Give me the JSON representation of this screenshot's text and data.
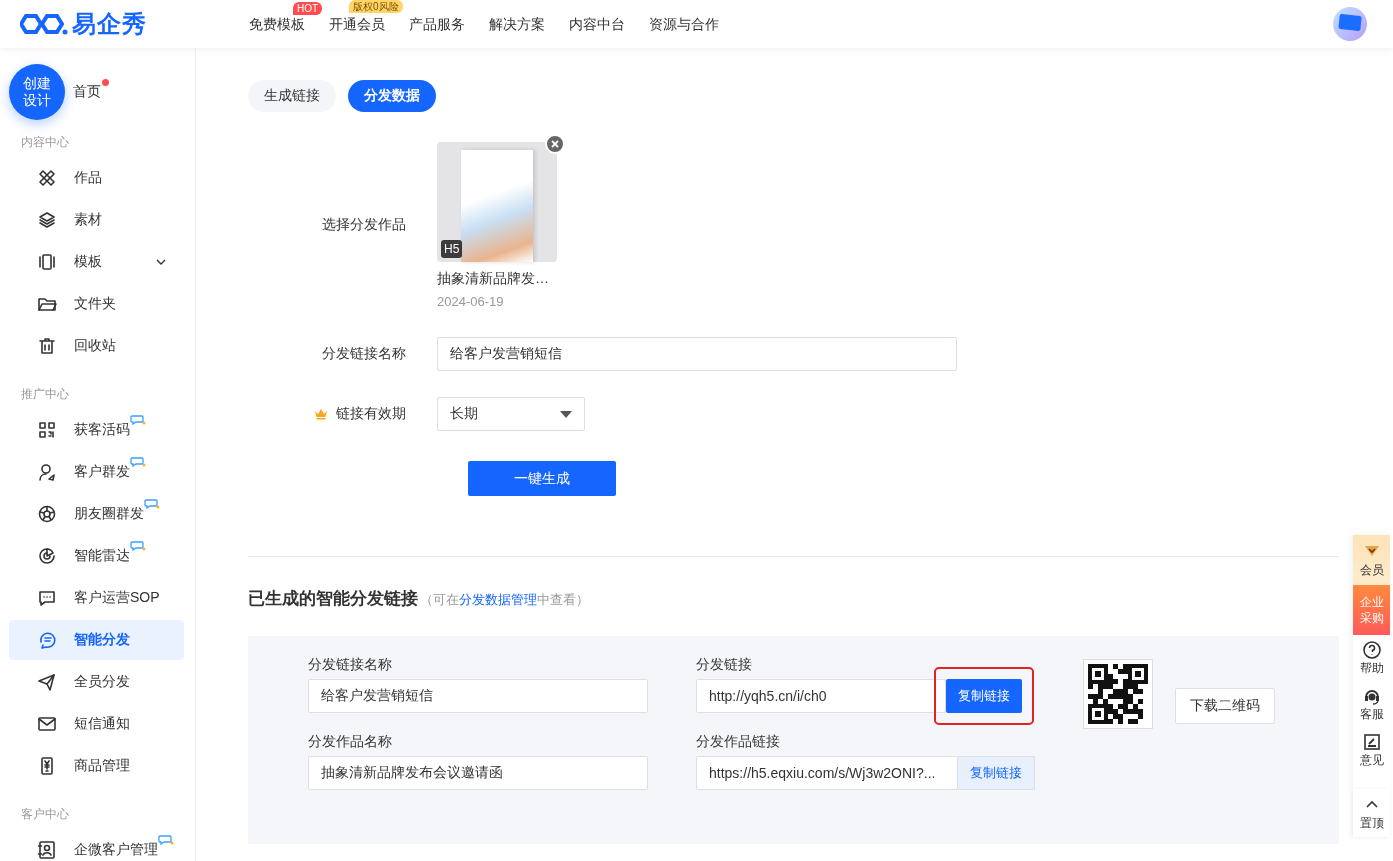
{
  "header": {
    "logo": "易企秀",
    "nav": [
      {
        "label": "免费模板",
        "badge": "HOT",
        "color": "#ff4d4f"
      },
      {
        "label": "开通会员",
        "badge": "版权0风险",
        "color": "#ffd666"
      },
      {
        "label": "产品服务"
      },
      {
        "label": "解决方案"
      },
      {
        "label": "内容中台"
      },
      {
        "label": "资源与合作"
      }
    ]
  },
  "sidebar": {
    "create_button": "创建设计",
    "home": {
      "label": "首页",
      "dot": true
    },
    "sections": [
      {
        "title": "内容中心",
        "items": [
          {
            "label": "作品",
            "kind": "tools",
            "selected": false
          },
          {
            "label": "素材",
            "kind": "layers",
            "selected": false
          },
          {
            "label": "模板",
            "kind": "template",
            "selected": false,
            "expandable": true
          },
          {
            "label": "文件夹",
            "kind": "folder",
            "selected": false
          },
          {
            "label": "回收站",
            "kind": "trash",
            "selected": false
          }
        ]
      },
      {
        "title": "推广中心",
        "items": [
          {
            "label": "获客活码",
            "kind": "qr",
            "selected": false,
            "new": true
          },
          {
            "label": "客户群发",
            "kind": "user-send",
            "selected": false,
            "new": true
          },
          {
            "label": "朋友圈群发",
            "kind": "aperture",
            "selected": false,
            "new": true
          },
          {
            "label": "智能雷达",
            "kind": "radar",
            "selected": false,
            "new": true
          },
          {
            "label": "客户运营SOP",
            "kind": "chat",
            "selected": false
          },
          {
            "label": "智能分发",
            "kind": "share",
            "selected": true
          },
          {
            "label": "全员分发",
            "kind": "plane",
            "selected": false
          },
          {
            "label": "短信通知",
            "kind": "mail",
            "selected": false
          },
          {
            "label": "商品管理",
            "kind": "phone",
            "selected": false
          }
        ]
      },
      {
        "title": "客户中心",
        "items": [
          {
            "label": "企微客户管理",
            "kind": "contact",
            "selected": false,
            "new": true
          }
        ]
      }
    ]
  },
  "tabs": [
    {
      "label": "生成链接",
      "selected": false
    },
    {
      "label": "分发数据",
      "selected": true
    }
  ],
  "form": {
    "work": {
      "label": "选择分发作品",
      "badge": "H5",
      "title": "抽象清新品牌发…",
      "date": "2024-06-19"
    },
    "name": {
      "label": "分发链接名称",
      "value": "给客户发营销短信"
    },
    "validity": {
      "label": "链接有效期",
      "value": "长期",
      "premium": true
    },
    "submit": "一键生成"
  },
  "generated": {
    "title": "已生成的智能分发链接",
    "note_before": "（可在",
    "note_link": "分发数据管理",
    "note_after": "中查看）",
    "fields": [
      {
        "label": "分发链接名称",
        "value": "给客户发营销短信"
      },
      {
        "label": "分发链接",
        "value": "http://yqh5.cn/i/ch0",
        "button": "复制链接",
        "primary": true,
        "highlighted": true
      },
      {
        "label": "分发作品名称",
        "value": "抽象清新品牌发布会议邀请函"
      },
      {
        "label": "分发作品链接",
        "value": "https://h5.eqxiu.com/s/Wj3w2ONI?...",
        "button": "复制链接",
        "primary": false,
        "highlighted": false
      }
    ],
    "download": "下载二维码"
  },
  "float_bar": [
    {
      "label": "会员",
      "kind": "vip"
    },
    {
      "label": "企业采购",
      "kind": "purchase"
    },
    {
      "label": "帮助",
      "kind": "help"
    },
    {
      "label": "客服",
      "kind": "service"
    },
    {
      "label": "意见",
      "kind": "feedback"
    },
    {
      "label": "置顶",
      "kind": "top"
    }
  ]
}
